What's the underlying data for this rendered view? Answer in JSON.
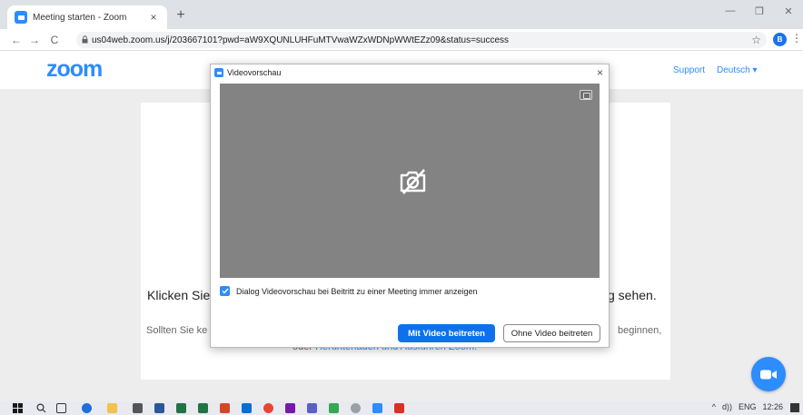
{
  "browser": {
    "tab_title": "Meeting starten - Zoom",
    "tab_close": "×",
    "new_tab": "+",
    "url": "us04web.zoom.us/j/203667101?pwd=aW9XQUNLUHFuMTVwaWZxWDNpWWtEZz09&status=success",
    "profile_initial": "B",
    "window_controls": [
      "—",
      "❐",
      "✕"
    ]
  },
  "zoom_page": {
    "logo": "zoom",
    "support": "Support",
    "language": "Deutsch ▾",
    "line1_left": "Klicken Sie",
    "line1_right": "g sehen.",
    "line2_left": "Sollten Sie ke",
    "line2_right": "beginnen,",
    "line3_prefix": "oder",
    "line3_link": "Herunterladen und Ausführen Zoom."
  },
  "dialog": {
    "title": "Videovorschau",
    "close": "×",
    "checkbox_label": "Dialog Videovorschau bei Beitritt zu einer Meeting immer anzeigen",
    "checkbox_checked": true,
    "join_with_video": "Mit Video beitreten",
    "join_without_video": "Ohne Video beitreten",
    "icons": [
      "camera-off-icon",
      "background-icon"
    ]
  },
  "taskbar": {
    "tray": [
      "^",
      "d))",
      "ENG"
    ],
    "clock": "12:26"
  },
  "colors": {
    "accent": "#2d8cff",
    "primary_button": "#0e71eb",
    "preview_bg": "#838384",
    "page_bg": "#ededed"
  }
}
